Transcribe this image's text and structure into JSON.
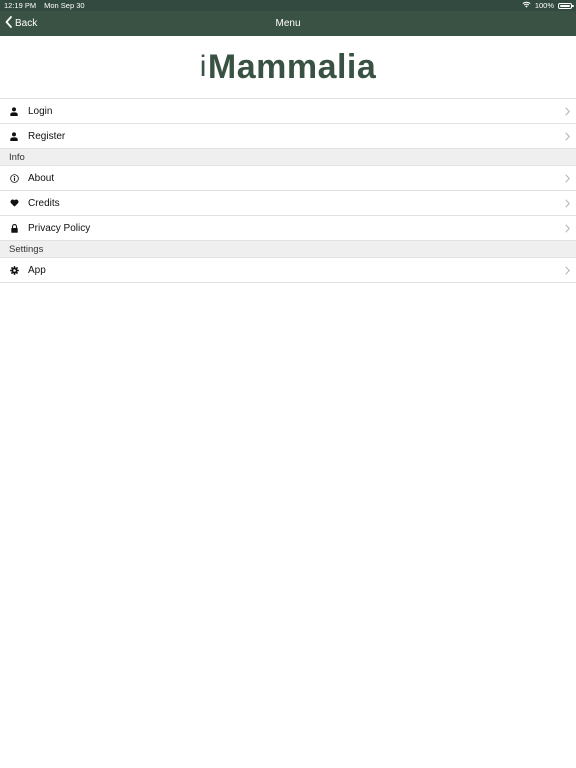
{
  "status_bar": {
    "time": "12:19 PM",
    "date": "Mon Sep 30",
    "battery": "100%"
  },
  "nav": {
    "back_label": "Back",
    "title": "Menu"
  },
  "logo": {
    "prefix": "i",
    "name": "Mammalia"
  },
  "account_items": [
    {
      "label": "Login",
      "icon": "user-icon"
    },
    {
      "label": "Register",
      "icon": "user-icon"
    }
  ],
  "sections": {
    "info": {
      "header": "Info",
      "items": [
        {
          "label": "About",
          "icon": "info-icon"
        },
        {
          "label": "Credits",
          "icon": "heart-icon"
        },
        {
          "label": "Privacy Policy",
          "icon": "lock-icon"
        }
      ]
    },
    "settings": {
      "header": "Settings",
      "items": [
        {
          "label": "App",
          "icon": "gear-icon"
        }
      ]
    }
  },
  "colors": {
    "brand": "#3a5244",
    "status_bar": "#334a40",
    "section_bg": "#efefef",
    "divider": "#e2e2e2",
    "chevron": "#b8b8b8"
  }
}
